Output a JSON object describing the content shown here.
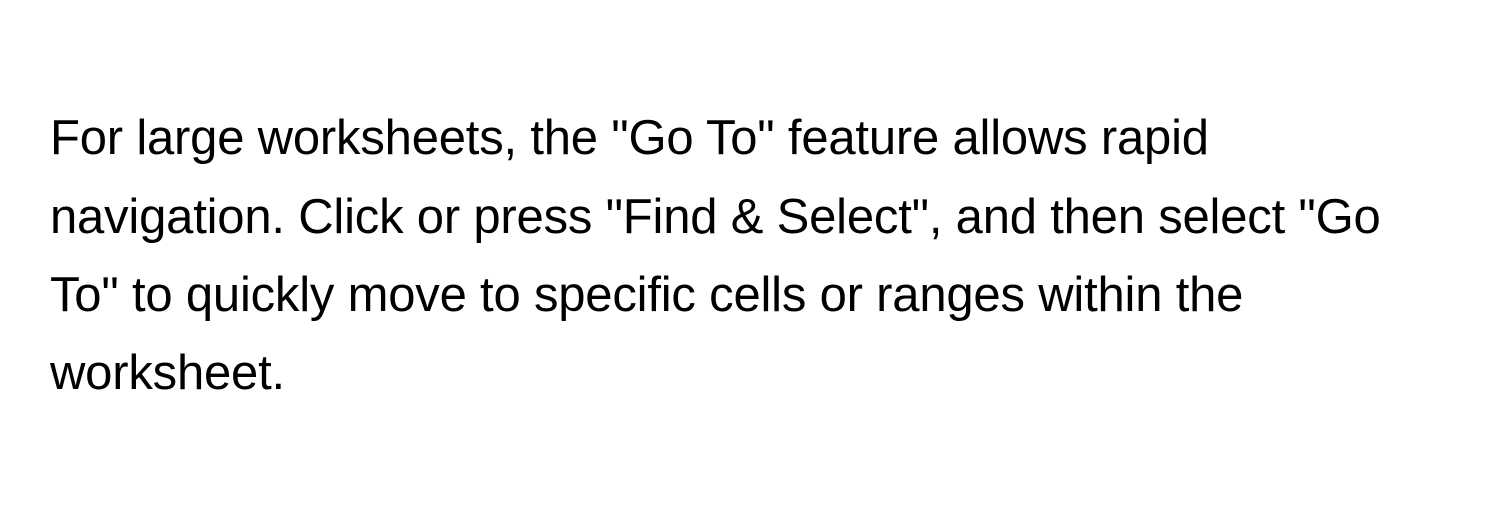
{
  "document": {
    "paragraph": "For large worksheets, the \"Go To\" feature allows rapid navigation. Click or press \"Find & Select\", and then select \"Go To\" to quickly move to specific cells or ranges within the worksheet."
  }
}
